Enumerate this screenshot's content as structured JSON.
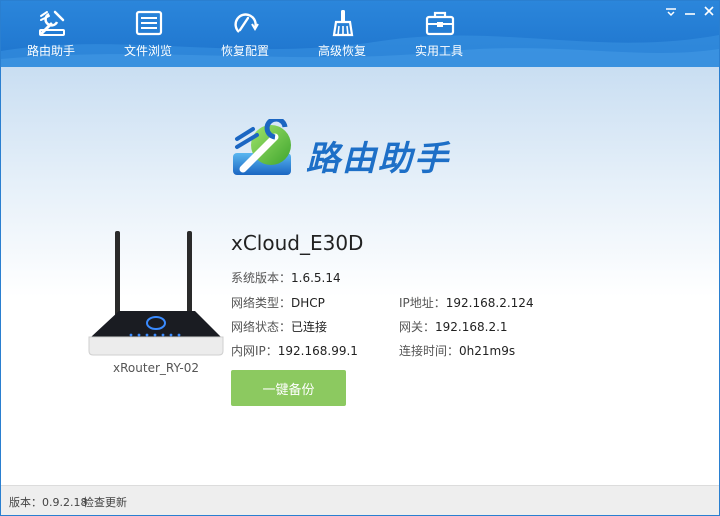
{
  "nav": {
    "items": [
      {
        "label": "路由助手",
        "icon": "router-tools-icon"
      },
      {
        "label": "文件浏览",
        "icon": "file-list-icon"
      },
      {
        "label": "恢复配置",
        "icon": "restore-config-icon"
      },
      {
        "label": "高级恢复",
        "icon": "broom-icon"
      },
      {
        "label": "实用工具",
        "icon": "toolbox-icon"
      }
    ]
  },
  "window_controls": {
    "minimize": "minimize-icon",
    "close": "close-icon"
  },
  "logo": {
    "text": "路由助手"
  },
  "device": {
    "model_caption": "xRouter_RY-02",
    "name": "xCloud_E30D",
    "fields": {
      "sys_version": {
        "label": "系统版本：",
        "value": "1.6.5.14"
      },
      "net_type": {
        "label": "网络类型：",
        "value": "DHCP"
      },
      "net_status": {
        "label": "网络状态：",
        "value": "已连接"
      },
      "lan_ip": {
        "label": "内网IP：",
        "value": "192.168.99.1"
      },
      "ip_addr": {
        "label": "IP地址：",
        "value": "192.168.2.124"
      },
      "gateway": {
        "label": "网关：",
        "value": "192.168.2.1"
      },
      "conn_time": {
        "label": "连接时间：",
        "value": "0h21m9s"
      }
    }
  },
  "actions": {
    "backup_label": "一键备份"
  },
  "status": {
    "version": "版本：0.9.2.18",
    "check_update": "检查更新"
  },
  "colors": {
    "accent": "#1d73cc",
    "button_green": "#8cc960",
    "logo_blue": "#1d6fc7"
  }
}
